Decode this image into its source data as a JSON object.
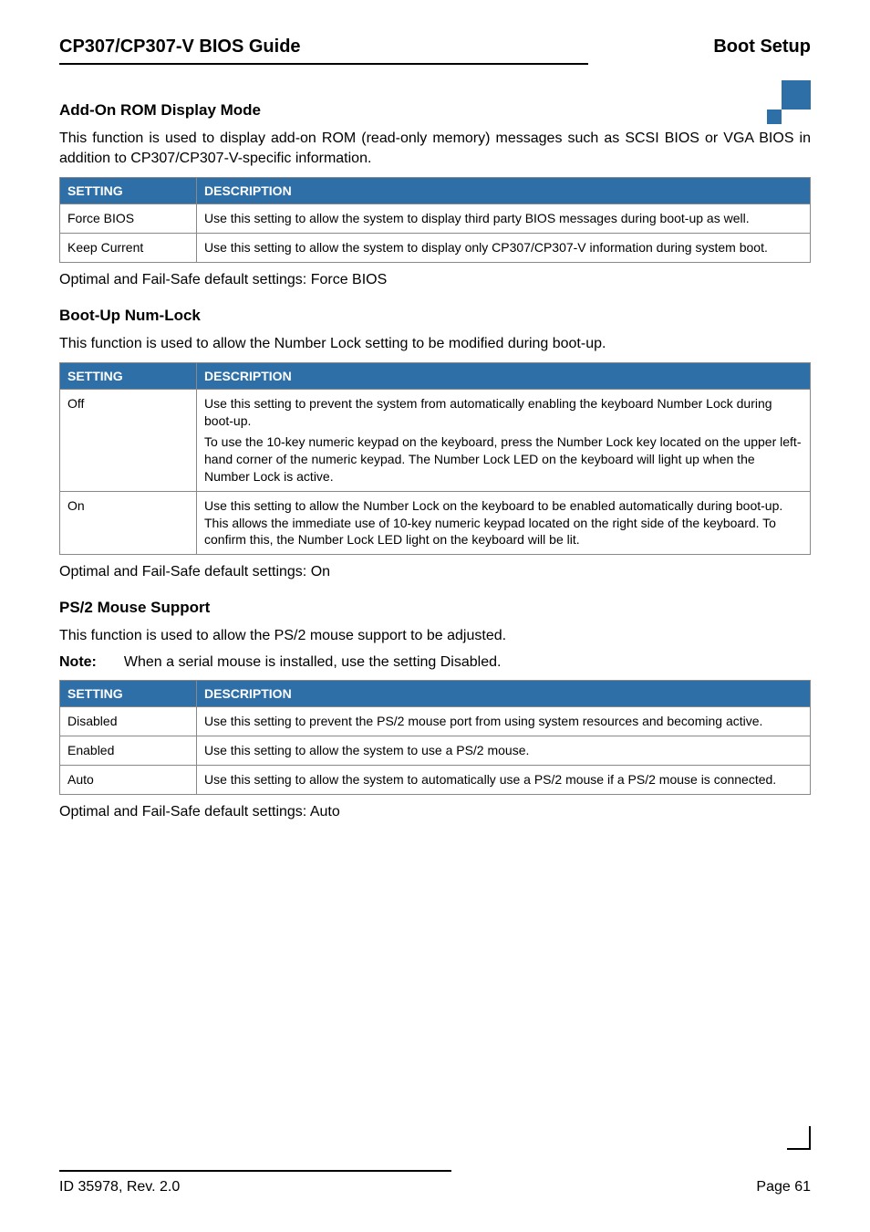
{
  "header": {
    "left": "CP307/CP307-V BIOS Guide",
    "right": "Boot Setup"
  },
  "section1": {
    "title": "Add-On ROM Display Mode",
    "intro": "This function is used to display add-on ROM (read-only memory) messages such as SCSI BIOS or VGA BIOS in addition to CP307/CP307-V-specific information.",
    "table": {
      "headers": [
        "SETTING",
        "DESCRIPTION"
      ],
      "rows": [
        {
          "setting": "Force BIOS",
          "desc": "Use this setting to allow the system to display third party BIOS messages during boot-up as well."
        },
        {
          "setting": "Keep Current",
          "desc": "Use this setting to allow the system to display only CP307/CP307-V information during system boot."
        }
      ]
    },
    "footer": "Optimal and Fail-Safe default settings: Force BIOS"
  },
  "section2": {
    "title": "Boot-Up Num-Lock",
    "intro": "This function is used to allow the Number Lock setting to be modified during boot-up.",
    "table": {
      "headers": [
        "SETTING",
        "DESCRIPTION"
      ],
      "rows": [
        {
          "setting": "Off",
          "desc_p1": "Use this setting to prevent the system from automatically enabling the keyboard Number Lock during boot-up.",
          "desc_p2": "To use the 10-key numeric keypad on the keyboard, press the Number Lock key located on the upper left-hand corner of the numeric keypad. The Number Lock LED on the keyboard will light up when the Number Lock is active."
        },
        {
          "setting": "On",
          "desc": "Use this setting to allow the Number Lock on the keyboard to be enabled automatically during boot-up. This allows the immediate use of 10-key numeric keypad located on the right side of the keyboard. To confirm this, the Number Lock LED light on the keyboard will be lit."
        }
      ]
    },
    "footer": "Optimal and Fail-Safe default settings: On"
  },
  "section3": {
    "title": "PS/2 Mouse Support",
    "intro": "This function is used to allow the PS/2 mouse support to be adjusted.",
    "note_label": "Note:",
    "note_text": "When a serial mouse is installed, use the setting Disabled.",
    "table": {
      "headers": [
        "SETTING",
        "DESCRIPTION"
      ],
      "rows": [
        {
          "setting": "Disabled",
          "desc": "Use this setting to prevent the PS/2 mouse port from using system resources and becoming active."
        },
        {
          "setting": "Enabled",
          "desc": "Use this setting to allow the system to use a PS/2 mouse."
        },
        {
          "setting": "Auto",
          "desc": "Use this setting to allow the system to automatically use a PS/2 mouse if a PS/2 mouse is connected."
        }
      ]
    },
    "footer": "Optimal and Fail-Safe default settings: Auto"
  },
  "page_footer": {
    "left": "ID 35978, Rev. 2.0",
    "right": "Page 61"
  }
}
